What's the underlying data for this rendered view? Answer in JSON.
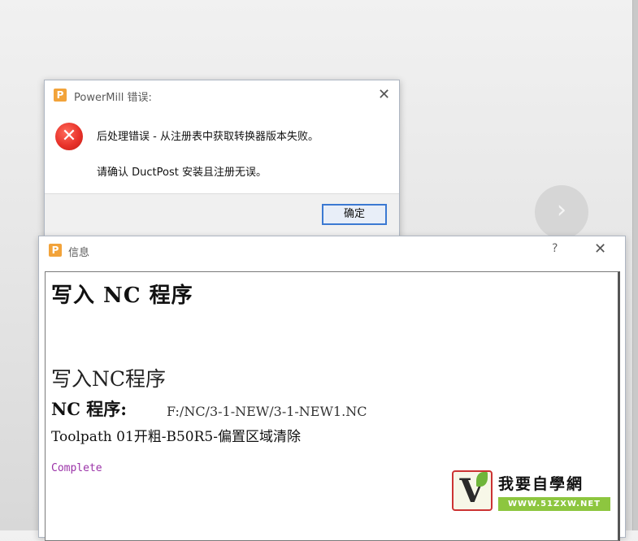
{
  "background": {
    "nav_arrow_icon": "chevron-right"
  },
  "error_dialog": {
    "app_icon_letter": "P",
    "title": "PowerMill 错误:",
    "close_icon": "✕",
    "message_line1": "后处理错误 - 从注册表中获取转换器版本失败。",
    "message_line2": "请确认 DuctPost 安装且注册无误。",
    "ok_label": "确定",
    "error_icon_glyph": "✕"
  },
  "info_window": {
    "app_icon_letter": "P",
    "title": "信息",
    "help_label": "?",
    "close_icon": "✕",
    "content": {
      "heading": "写入 NC 程序",
      "subheading": "写入NC程序",
      "nc_label": "NC 程序:",
      "nc_path": "F:/NC/3-1-NEW/3-1-NEW1.NC",
      "toolpath": "Toolpath 01开粗-B50R5-偏置区域清除",
      "status": "Complete"
    }
  },
  "watermark": {
    "logo_letter": "V",
    "text_cn": "我要自學網",
    "text_url": "WWW.51ZXW.NET"
  },
  "colors": {
    "error_red": "#e8322a",
    "ok_button_border": "#3b79d2",
    "status_purple": "#9b33a8",
    "logo_orange": "#f2a33a",
    "watermark_green": "#8dc63f"
  }
}
